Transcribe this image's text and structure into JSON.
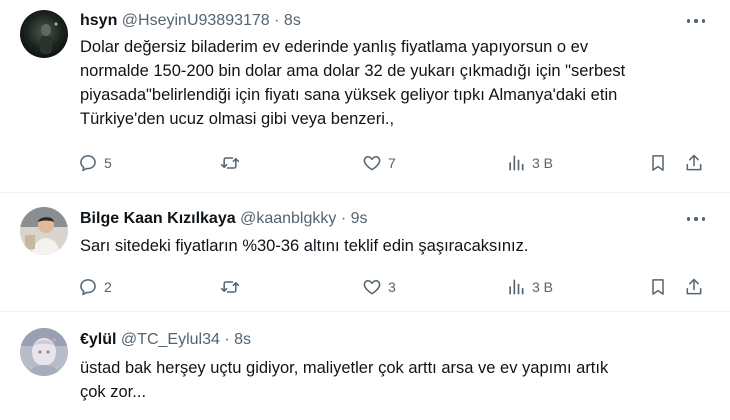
{
  "tweets": [
    {
      "name": "hsyn",
      "handle": "@HseyinU93893178",
      "separator": "·",
      "time": "8s",
      "lines": [
        "Dolar değersiz biladerim ev ederinde yanlış fiyatlama yapıyorsun o ev",
        "normalde 150-200 bin dolar ama dolar 32 de yukarı çıkmadığı için \"serbest",
        "piyasada\"belirlendiği için fiyatı sana yüksek geliyor tıpkı Almanya'daki etin",
        "Türkiye'den ucuz olmasi gibi veya benzeri.,"
      ],
      "replies": "5",
      "reposts": "",
      "likes": "7",
      "views": "3 B"
    },
    {
      "name": "Bilge Kaan Kızılkaya",
      "handle": "@kaanblgkky",
      "separator": "·",
      "time": "9s",
      "lines": [
        "Sarı sitedeki fiyatların %30-36 altını teklif edin  şaşıracaksınız."
      ],
      "replies": "2",
      "reposts": "",
      "likes": "3",
      "views": "3 B"
    },
    {
      "name": "€ylül",
      "handle": "@TC_Eylul34",
      "separator": "·",
      "time": "8s",
      "lines": [
        "üstad bak herşey uçtu gidiyor, maliyetler çok arttı arsa ve ev yapımı artık",
        "çok zor..."
      ]
    }
  ],
  "icons": {
    "more": "more-horizontal-icon",
    "reply": "reply-icon",
    "repost": "repost-icon",
    "like": "heart-icon",
    "views": "views-chart-icon",
    "bookmark": "bookmark-icon",
    "share": "share-icon"
  },
  "colors": {
    "text": "#0f1419",
    "secondary": "#536471",
    "divider": "#eff3f4"
  }
}
